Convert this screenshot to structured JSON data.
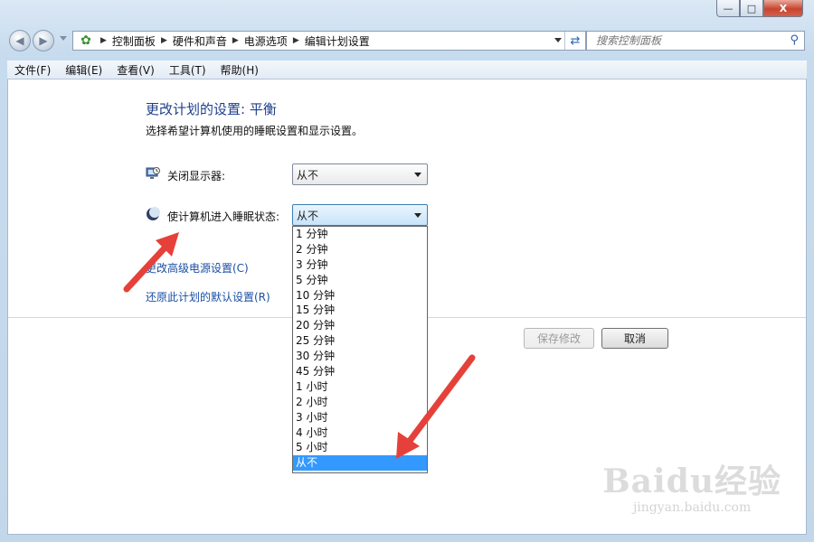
{
  "window": {
    "caption_buttons": [
      "—",
      "□",
      "X"
    ]
  },
  "nav": {
    "back_icon": "back-arrow-icon",
    "forward_icon": "forward-arrow-icon",
    "breadcrumbs": [
      "控制面板",
      "硬件和声音",
      "电源选项",
      "编辑计划设置"
    ],
    "search_placeholder": "搜索控制面板"
  },
  "menu": [
    "文件(F)",
    "编辑(E)",
    "查看(V)",
    "工具(T)",
    "帮助(H)"
  ],
  "page": {
    "title": "更改计划的设置: 平衡",
    "subtitle": "选择希望计算机使用的睡眠设置和显示设置。",
    "display_off_label": "关闭显示器:",
    "display_off_value": "从不",
    "sleep_label": "使计算机进入睡眠状态:",
    "sleep_value": "从不",
    "advanced_link": "更改高级电源设置(C)",
    "restore_link": "还原此计划的默认设置(R)",
    "save_button": "保存修改",
    "cancel_button": "取消"
  },
  "sleep_options": [
    "1 分钟",
    "2 分钟",
    "3 分钟",
    "5 分钟",
    "10 分钟",
    "15 分钟",
    "20 分钟",
    "25 分钟",
    "30 分钟",
    "45 分钟",
    "1 小时",
    "2 小时",
    "3 小时",
    "4 小时",
    "5 小时",
    "从不"
  ],
  "selected_option_index": 15,
  "watermark": {
    "logo": "Baidu经验",
    "url": "jingyan.baidu.com"
  },
  "colors": {
    "link": "#1a4fa3",
    "title": "#1e3f8a",
    "highlight": "#3399ff",
    "annotation_arrow": "#e5413a"
  }
}
